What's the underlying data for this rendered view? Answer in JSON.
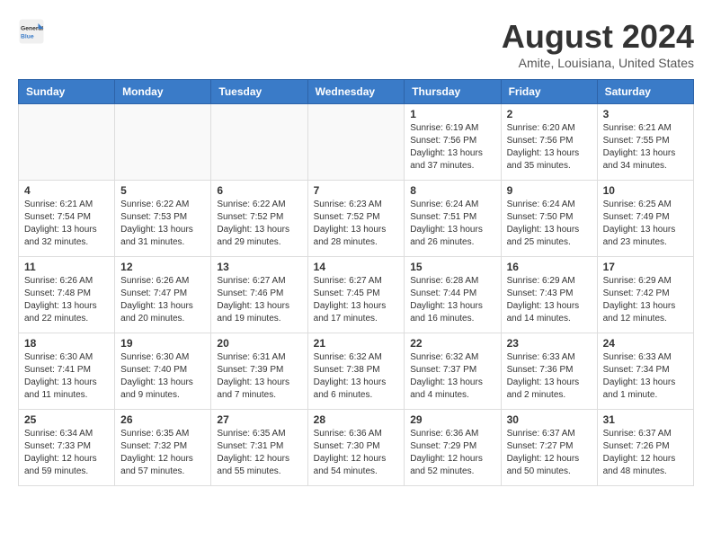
{
  "header": {
    "logo_general": "General",
    "logo_blue": "Blue",
    "month_title": "August 2024",
    "location": "Amite, Louisiana, United States"
  },
  "weekdays": [
    "Sunday",
    "Monday",
    "Tuesday",
    "Wednesday",
    "Thursday",
    "Friday",
    "Saturday"
  ],
  "weeks": [
    [
      {
        "day": "",
        "info": ""
      },
      {
        "day": "",
        "info": ""
      },
      {
        "day": "",
        "info": ""
      },
      {
        "day": "",
        "info": ""
      },
      {
        "day": "1",
        "info": "Sunrise: 6:19 AM\nSunset: 7:56 PM\nDaylight: 13 hours\nand 37 minutes."
      },
      {
        "day": "2",
        "info": "Sunrise: 6:20 AM\nSunset: 7:56 PM\nDaylight: 13 hours\nand 35 minutes."
      },
      {
        "day": "3",
        "info": "Sunrise: 6:21 AM\nSunset: 7:55 PM\nDaylight: 13 hours\nand 34 minutes."
      }
    ],
    [
      {
        "day": "4",
        "info": "Sunrise: 6:21 AM\nSunset: 7:54 PM\nDaylight: 13 hours\nand 32 minutes."
      },
      {
        "day": "5",
        "info": "Sunrise: 6:22 AM\nSunset: 7:53 PM\nDaylight: 13 hours\nand 31 minutes."
      },
      {
        "day": "6",
        "info": "Sunrise: 6:22 AM\nSunset: 7:52 PM\nDaylight: 13 hours\nand 29 minutes."
      },
      {
        "day": "7",
        "info": "Sunrise: 6:23 AM\nSunset: 7:52 PM\nDaylight: 13 hours\nand 28 minutes."
      },
      {
        "day": "8",
        "info": "Sunrise: 6:24 AM\nSunset: 7:51 PM\nDaylight: 13 hours\nand 26 minutes."
      },
      {
        "day": "9",
        "info": "Sunrise: 6:24 AM\nSunset: 7:50 PM\nDaylight: 13 hours\nand 25 minutes."
      },
      {
        "day": "10",
        "info": "Sunrise: 6:25 AM\nSunset: 7:49 PM\nDaylight: 13 hours\nand 23 minutes."
      }
    ],
    [
      {
        "day": "11",
        "info": "Sunrise: 6:26 AM\nSunset: 7:48 PM\nDaylight: 13 hours\nand 22 minutes."
      },
      {
        "day": "12",
        "info": "Sunrise: 6:26 AM\nSunset: 7:47 PM\nDaylight: 13 hours\nand 20 minutes."
      },
      {
        "day": "13",
        "info": "Sunrise: 6:27 AM\nSunset: 7:46 PM\nDaylight: 13 hours\nand 19 minutes."
      },
      {
        "day": "14",
        "info": "Sunrise: 6:27 AM\nSunset: 7:45 PM\nDaylight: 13 hours\nand 17 minutes."
      },
      {
        "day": "15",
        "info": "Sunrise: 6:28 AM\nSunset: 7:44 PM\nDaylight: 13 hours\nand 16 minutes."
      },
      {
        "day": "16",
        "info": "Sunrise: 6:29 AM\nSunset: 7:43 PM\nDaylight: 13 hours\nand 14 minutes."
      },
      {
        "day": "17",
        "info": "Sunrise: 6:29 AM\nSunset: 7:42 PM\nDaylight: 13 hours\nand 12 minutes."
      }
    ],
    [
      {
        "day": "18",
        "info": "Sunrise: 6:30 AM\nSunset: 7:41 PM\nDaylight: 13 hours\nand 11 minutes."
      },
      {
        "day": "19",
        "info": "Sunrise: 6:30 AM\nSunset: 7:40 PM\nDaylight: 13 hours\nand 9 minutes."
      },
      {
        "day": "20",
        "info": "Sunrise: 6:31 AM\nSunset: 7:39 PM\nDaylight: 13 hours\nand 7 minutes."
      },
      {
        "day": "21",
        "info": "Sunrise: 6:32 AM\nSunset: 7:38 PM\nDaylight: 13 hours\nand 6 minutes."
      },
      {
        "day": "22",
        "info": "Sunrise: 6:32 AM\nSunset: 7:37 PM\nDaylight: 13 hours\nand 4 minutes."
      },
      {
        "day": "23",
        "info": "Sunrise: 6:33 AM\nSunset: 7:36 PM\nDaylight: 13 hours\nand 2 minutes."
      },
      {
        "day": "24",
        "info": "Sunrise: 6:33 AM\nSunset: 7:34 PM\nDaylight: 13 hours\nand 1 minute."
      }
    ],
    [
      {
        "day": "25",
        "info": "Sunrise: 6:34 AM\nSunset: 7:33 PM\nDaylight: 12 hours\nand 59 minutes."
      },
      {
        "day": "26",
        "info": "Sunrise: 6:35 AM\nSunset: 7:32 PM\nDaylight: 12 hours\nand 57 minutes."
      },
      {
        "day": "27",
        "info": "Sunrise: 6:35 AM\nSunset: 7:31 PM\nDaylight: 12 hours\nand 55 minutes."
      },
      {
        "day": "28",
        "info": "Sunrise: 6:36 AM\nSunset: 7:30 PM\nDaylight: 12 hours\nand 54 minutes."
      },
      {
        "day": "29",
        "info": "Sunrise: 6:36 AM\nSunset: 7:29 PM\nDaylight: 12 hours\nand 52 minutes."
      },
      {
        "day": "30",
        "info": "Sunrise: 6:37 AM\nSunset: 7:27 PM\nDaylight: 12 hours\nand 50 minutes."
      },
      {
        "day": "31",
        "info": "Sunrise: 6:37 AM\nSunset: 7:26 PM\nDaylight: 12 hours\nand 48 minutes."
      }
    ]
  ]
}
